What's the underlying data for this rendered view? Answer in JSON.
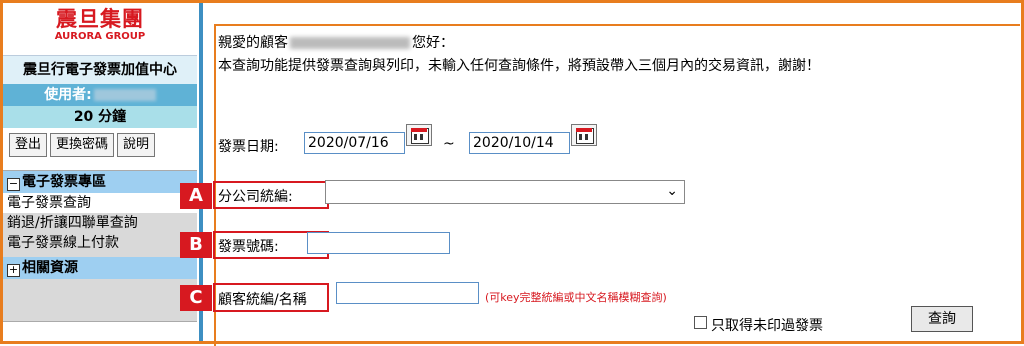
{
  "sidebar": {
    "logo_zh": "震旦集團",
    "logo_en": "AURORA GROUP",
    "brand": "震旦行電子發票加值中心",
    "user_label": "使用者:",
    "timer": "20 分鐘",
    "buttons": [
      "登出",
      "更換密碼",
      "說明"
    ],
    "menu": {
      "section1": "電子發票專區",
      "items": [
        "電子發票查詢",
        "銷退/折讓四聯單查詢",
        "電子發票線上付款"
      ],
      "section2": "相關資源"
    }
  },
  "main": {
    "greeting_pre": "親愛的顧客",
    "greeting_post": "您好：",
    "notice": "本查詢功能提供發票查詢與列印，未輸入任何查詢條件，將預設帶入三個月內的交易資訊，謝謝！",
    "date_label": "發票日期:",
    "date_from": "2020/07/16",
    "tilde": "~",
    "date_to": "2020/10/14",
    "branch_label": "分公司統編:",
    "branch_value": "",
    "invoice_label": "發票號碼:",
    "invoice_value": "",
    "customer_label": "顧客統編/名稱",
    "customer_value": "",
    "hint": "(可key完整統編或中文名稱模糊查詢)",
    "checkbox_label": "只取得未印過發票",
    "query_button": "查詢"
  },
  "annotations": {
    "badges": [
      "A",
      "B",
      "C"
    ]
  },
  "colors": {
    "frame": "#e87d1e",
    "accent_red": "#d71920",
    "menu_header": "#9ecff1",
    "user_bar": "#5fb2d6"
  }
}
